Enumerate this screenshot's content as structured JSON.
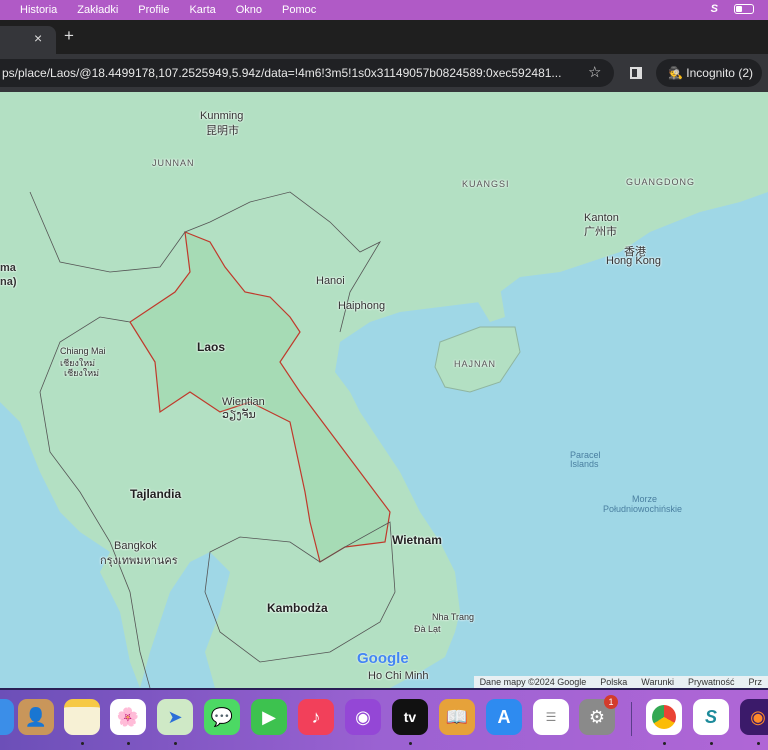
{
  "menubar": {
    "items": [
      "Historia",
      "Zakładki",
      "Profile",
      "Karta",
      "Okno",
      "Pomoc"
    ]
  },
  "tabbar": {
    "close": "×",
    "new_tab": "+"
  },
  "address": {
    "url": "ps/place/Laos/@18.4499178,107.2525949,5.94z/data=!4m6!3m5!1s0x31149057b0824589:0xec592481...",
    "star": "☆",
    "incognito": "Incognito (2)"
  },
  "map": {
    "labels": {
      "kunming": "Kunming",
      "kunming_cn": "昆明市",
      "junnan": "JUNNAN",
      "kuangsi": "KUANGSI",
      "guangdong": "GUANGDONG",
      "kanton": "Kanton",
      "kanton_cn": "广州市",
      "hk_cn": "香港",
      "hong_kong": "Hong Kong",
      "hanoi": "Hanoi",
      "haiphong": "Haiphong",
      "hajnan": "HAJNAN",
      "laos": "Laos",
      "chiang_mai": "Chiang Mai",
      "chiang_mai_th": "เชียงใหม่",
      "chiang_mai_th2": "เชียงใหม่",
      "wientian": "Wientian",
      "wientian_lo": "ວຽງຈັນ",
      "tajlandia": "Tajlandia",
      "bangkok": "Bangkok",
      "bangkok_th": "กรุงเทพมหานคร",
      "wietnam": "Wietnam",
      "kambodza": "Kambodża",
      "nha_trang": "Nha Trang",
      "da_lat": "Đà Lạt",
      "ho_chi_minh": "Ho Chi Minh",
      "paracel": "Paracel",
      "paracel2": "Islands",
      "morze": "Morze",
      "morze2": "Południowochińskie",
      "myanmar1": "ma",
      "myanmar2": "na)"
    },
    "google_logo": "Google",
    "attribution": [
      "Dane mapy ©2024 Google",
      "Polska",
      "Warunki",
      "Prywatność",
      "Prz"
    ]
  },
  "dock": {
    "badge": "1",
    "apps": [
      "Finder",
      "Contacts",
      "Notes",
      "Photos",
      "Maps",
      "Messages",
      "FaceTime",
      "Music",
      "Podcasts",
      "TV",
      "Books",
      "App Store",
      "Reminders",
      "System Settings",
      "Chrome",
      "Surfshark",
      "Firefox"
    ],
    "tv_label": "tv"
  },
  "colors": {
    "menubar": "#b05ac6",
    "land": "#aee0c0",
    "sea": "#8fd0e0",
    "laos_border": "#c0392b"
  }
}
